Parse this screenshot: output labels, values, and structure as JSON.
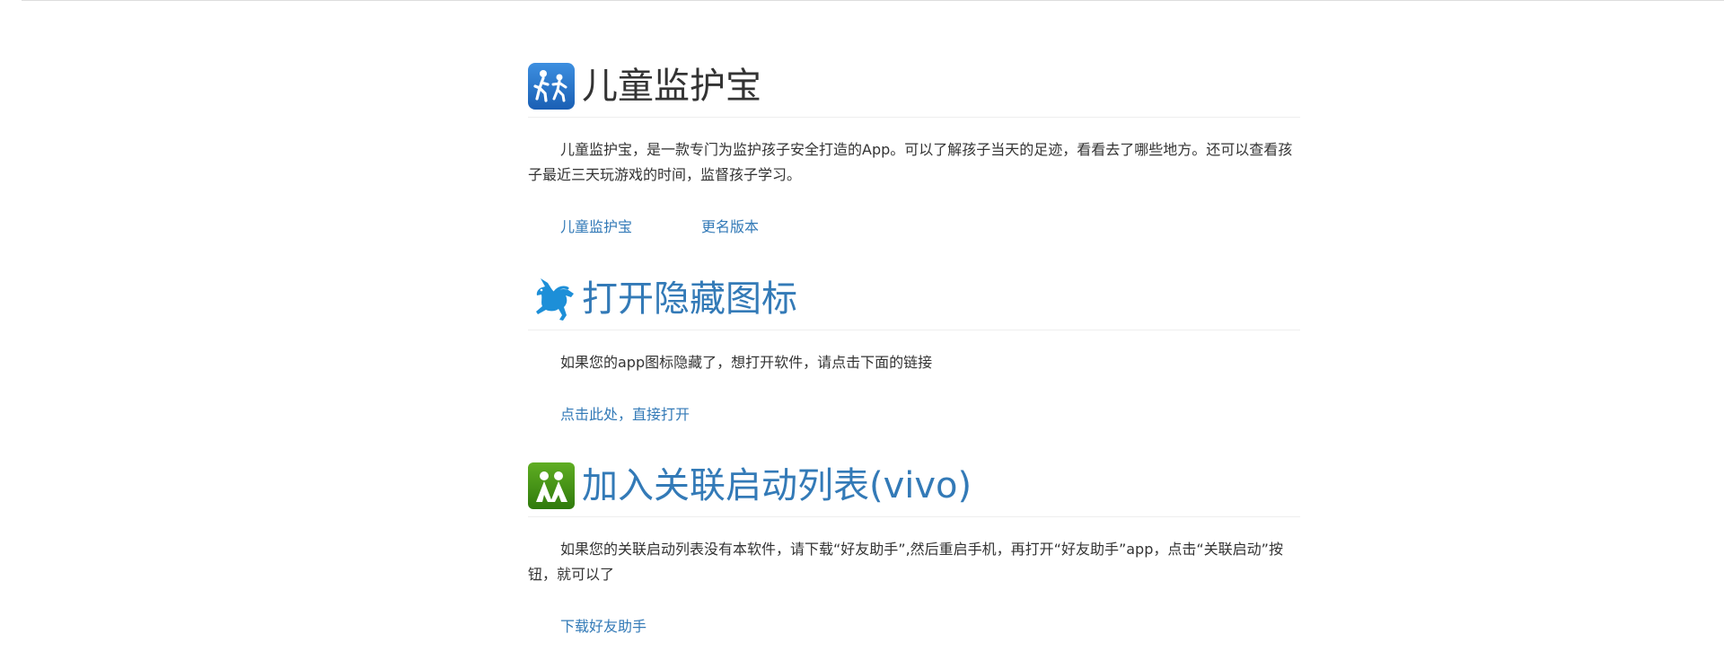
{
  "sections": [
    {
      "title": "儿童监护宝",
      "icon": "child-guardian-icon",
      "description": "儿童监护宝，是一款专门为监护孩子安全打造的App。可以了解孩子当天的足迹，看看去了哪些地方。还可以查看孩子最近三天玩游戏的时间，监督孩子学习。",
      "links": [
        "儿童监护宝",
        "更名版本"
      ]
    },
    {
      "title": "打开隐藏图标",
      "icon": "unicorn-icon",
      "description": "如果您的app图标隐藏了，想打开软件，请点击下面的链接",
      "links": [
        "点击此处，直接打开"
      ]
    },
    {
      "title": "加入关联启动列表(vivo)",
      "icon": "friends-helper-icon",
      "description": "如果您的关联启动列表没有本软件，请下载“好友助手”,然后重启手机，再打开“好友助手”app，点击“关联启动”按钮，就可以了",
      "links": [
        "下载好友助手"
      ]
    }
  ],
  "colors": {
    "link": "#337ab7",
    "text": "#333333",
    "divider": "#eeeeee"
  }
}
